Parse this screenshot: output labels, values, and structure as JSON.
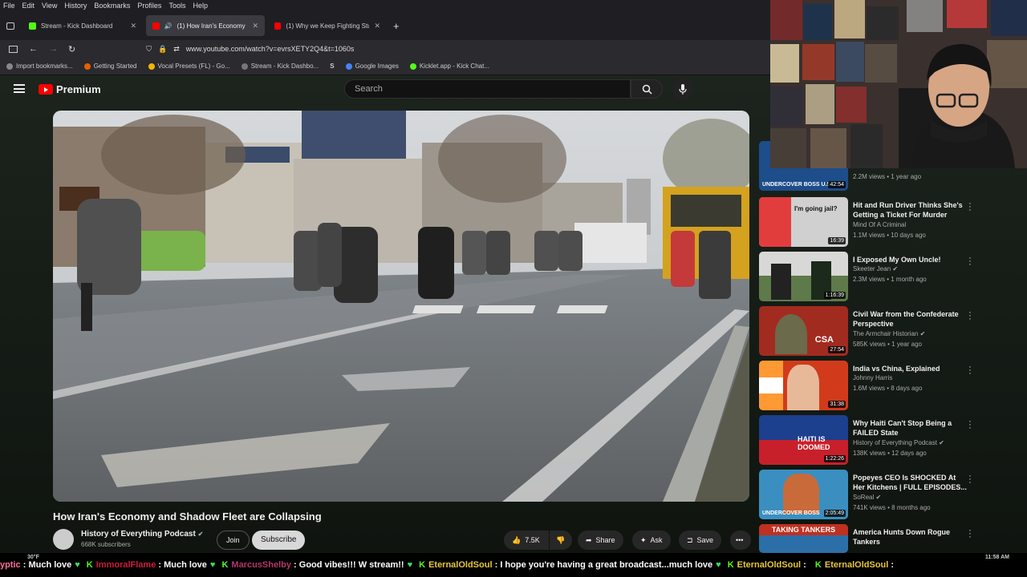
{
  "menubar": [
    "File",
    "Edit",
    "View",
    "History",
    "Bookmarks",
    "Profiles",
    "Tools",
    "Help"
  ],
  "tabs": [
    {
      "label": "Stream - Kick Dashboard",
      "icon": "kick-icon"
    },
    {
      "label": "(1) How Iran's Economy an...",
      "icon": "youtube-icon"
    },
    {
      "label": "(1) Why we Keep Fighting Stupi...",
      "icon": "youtube-icon"
    }
  ],
  "url": "www.youtube.com/watch?v=evrsXETY2Q4&t=1060s",
  "bookmarks": [
    "Import bookmarks...",
    "Getting Started",
    "Vocal Presets (FL) - Go...",
    "Stream - Kick Dashbo...",
    "Google Images",
    "Kicklet.app - Kick Chat..."
  ],
  "youtube": {
    "logo": "Premium",
    "search_placeholder": "Search",
    "video_title": "How Iran's Economy and Shadow Fleet are Collapsing",
    "channel": "History of Everything Podcast",
    "subscribers": "668K subscribers",
    "join": "Join",
    "subscribe": "Subscribe",
    "likes": "7.5K",
    "share": "Share",
    "ask": "Ask",
    "save": "Save"
  },
  "recommendations": [
    {
      "title": "",
      "channel": "",
      "meta": "2.2M views • 1 year ago",
      "duration": "42:54",
      "thumb_text": "UNDERCOVER BOSS U.S.",
      "color": "#1d4d8a"
    },
    {
      "title": "Hit and Run Driver Thinks She's Getting a Ticket For Murder",
      "channel": "Mind Of A Criminal",
      "meta": "1.1M views • 10 days ago",
      "duration": "16:39",
      "thumb_text": "I'm going jail?",
      "color": "#d0d0d0"
    },
    {
      "title": "I Exposed My Own Uncle!",
      "channel": "Skeeter Jean",
      "meta": "2.3M views • 1 month ago",
      "duration": "1:16:39",
      "thumb_text": "",
      "color": "#5e7a4a"
    },
    {
      "title": "Civil War from the Confederate Perspective",
      "channel": "The Armchair Historian",
      "meta": "585K views • 1 year ago",
      "duration": "27:54",
      "thumb_text": "CSA",
      "color": "#a22b1f"
    },
    {
      "title": "India vs China, Explained",
      "channel": "Johnny Harris",
      "meta": "1.6M views • 8 days ago",
      "duration": "31:38",
      "thumb_text": "",
      "color": "#d23a1c"
    },
    {
      "title": "Why Haiti Can't Stop Being a FAILED State",
      "channel": "History of Everything Podcast",
      "meta": "138K views • 12 days ago",
      "duration": "1:22:26",
      "thumb_text": "HAITI IS DOOMED",
      "color": "#1c3f8e"
    },
    {
      "title": "Popeyes CEO Is SHOCKED At Her Kitchens | FULL EPISODES...",
      "channel": "SoReal",
      "meta": "741K views • 8 months ago",
      "duration": "2:05:49",
      "thumb_text": "UNDERCOVER BOSS",
      "color": "#3a8fc0"
    },
    {
      "title": "America Hunts Down Rogue Tankers",
      "channel": "",
      "meta": "",
      "duration": "",
      "thumb_text": "TAKING TANKERS",
      "color": "#2c6fa8"
    }
  ],
  "ticker": [
    {
      "user": "yptic",
      "msg": "Much love"
    },
    {
      "user": "ImmoralFlame",
      "msg": "Much love"
    },
    {
      "user": "MarcusShelby",
      "msg": "Good vibes!!! W stream!!"
    },
    {
      "user": "EternalOldSoul",
      "msg": "I hope you're having a great broadcast...much love"
    },
    {
      "user": "EternalOldSoul",
      "msg": ""
    },
    {
      "user": "EternalOldSoul",
      "msg": ""
    }
  ],
  "taskbar": {
    "time": "11:58 AM",
    "temp": "30°F"
  },
  "colors": {
    "accent": "#ff0000",
    "kick": "#53fc18"
  }
}
